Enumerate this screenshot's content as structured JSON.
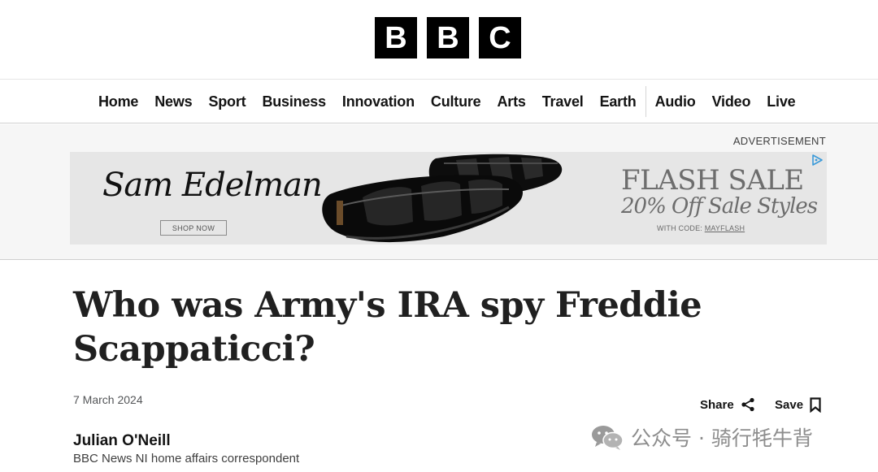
{
  "logo": {
    "letters": [
      "B",
      "B",
      "C"
    ]
  },
  "nav": {
    "items": [
      "Home",
      "News",
      "Sport",
      "Business",
      "Innovation",
      "Culture",
      "Arts",
      "Travel",
      "Earth",
      "Audio",
      "Video",
      "Live"
    ]
  },
  "advertisement": {
    "label": "ADVERTISEMENT",
    "brand": "Sam Edelman",
    "shop_now": "SHOP NOW",
    "headline": "FLASH SALE",
    "offer": "20% Off Sale Styles",
    "code_prefix": "WITH CODE: ",
    "code": "MAYFLASH",
    "adchoices_icon": "adchoices-icon"
  },
  "article": {
    "headline": "Who was Army's IRA spy Freddie Scappaticci?",
    "date": "7 March 2024",
    "share_label": "Share",
    "save_label": "Save",
    "author": "Julian O'Neill",
    "author_role": "BBC News NI home affairs correspondent"
  },
  "watermark": {
    "text": "公众号 · 骑行牦牛背",
    "icon": "wechat-icon"
  },
  "colors": {
    "brand_black": "#000000",
    "text": "#141414",
    "ad_bg": "#f6f6f6"
  }
}
